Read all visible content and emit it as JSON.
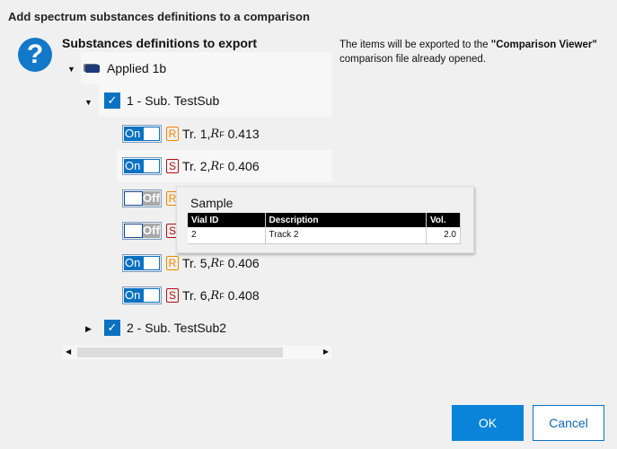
{
  "dialog": {
    "title": "Add spectrum substances definitions to a comparison",
    "icon": "question-icon",
    "section_title": "Substances definitions to export",
    "info_prefix": "The items will be exported to the ",
    "info_bold": "\"Comparison Viewer\"",
    "info_suffix": " comparison file already opened."
  },
  "tree": {
    "root": {
      "label": "Applied 1b",
      "icon": "plate-icon",
      "expanded": true
    },
    "substances": [
      {
        "label": "1 - Sub. TestSub",
        "checked": true,
        "expanded": true
      },
      {
        "label": "2 - Sub. TestSub2",
        "checked": true,
        "expanded": false
      }
    ],
    "tracks": [
      {
        "toggle": "On",
        "type": "R",
        "label": "Tr. 1, ",
        "rf_r": "R",
        "rf_f": "F",
        "rf": " 0.413"
      },
      {
        "toggle": "On",
        "type": "S",
        "label": "Tr. 2, ",
        "rf_r": "R",
        "rf_f": "F",
        "rf": " 0.406"
      },
      {
        "toggle": "Off",
        "type": "R",
        "label": "",
        "rf_r": "",
        "rf_f": "",
        "rf": ""
      },
      {
        "toggle": "Off",
        "type": "S",
        "label": "",
        "rf_r": "",
        "rf_f": "",
        "rf": ""
      },
      {
        "toggle": "On",
        "type": "R",
        "label": "Tr. 5, ",
        "rf_r": "R",
        "rf_f": "F",
        "rf": " 0.406"
      },
      {
        "toggle": "On",
        "type": "S",
        "label": "Tr. 6, ",
        "rf_r": "R",
        "rf_f": "F",
        "rf": " 0.408"
      }
    ]
  },
  "tooltip": {
    "title": "Sample",
    "columns": [
      "Vial ID",
      "Description",
      "Vol."
    ],
    "row": [
      "2",
      "Track 2",
      "2.0"
    ]
  },
  "buttons": {
    "ok": "OK",
    "cancel": "Cancel"
  },
  "colors": {
    "accent": "#0a72c2",
    "reference": "#f08a00",
    "sample": "#b01010"
  }
}
